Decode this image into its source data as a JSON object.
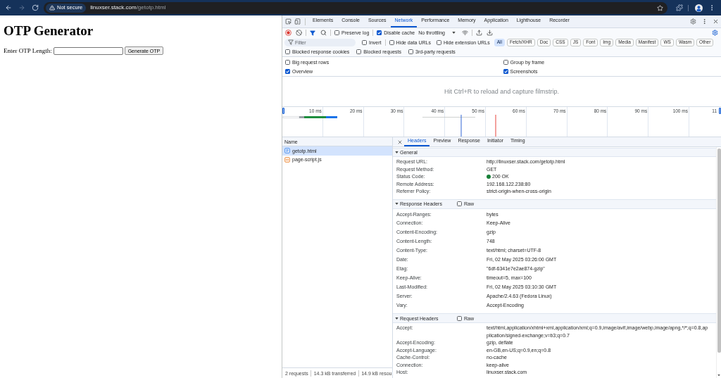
{
  "browser": {
    "security_chip": "Not secure",
    "url_host": "linuxser.stack.com",
    "url_path": "/getotp.html"
  },
  "page": {
    "heading": "OTP Generator",
    "length_label": "Enter OTP Length:",
    "submit_button": "Generate OTP"
  },
  "devtools": {
    "tabs": [
      {
        "label": "Elements",
        "selected": false
      },
      {
        "label": "Console",
        "selected": false
      },
      {
        "label": "Sources",
        "selected": false
      },
      {
        "label": "Network",
        "selected": true
      },
      {
        "label": "Performance",
        "selected": false
      },
      {
        "label": "Memory",
        "selected": false
      },
      {
        "label": "Application",
        "selected": false
      },
      {
        "label": "Lighthouse",
        "selected": false
      },
      {
        "label": "Recorder",
        "selected": false
      }
    ],
    "toolbar": {
      "recording": true,
      "filter_open": true,
      "options": [
        {
          "label": "Preserve log",
          "checked": false
        },
        {
          "label": "Disable cache",
          "checked": true
        }
      ],
      "throttling": "No throttling",
      "settings_open": true
    },
    "filter": {
      "placeholder": "Filter",
      "options": [
        {
          "label": "Invert",
          "checked": false
        },
        {
          "label": "Hide data URLs",
          "checked": false
        },
        {
          "label": "Hide extension URLs",
          "checked": false
        }
      ],
      "types": [
        {
          "label": "All",
          "selected": true
        },
        {
          "label": "Fetch/XHR",
          "selected": false
        },
        {
          "label": "Doc",
          "selected": false
        },
        {
          "label": "CSS",
          "selected": false
        },
        {
          "label": "JS",
          "selected": false
        },
        {
          "label": "Font",
          "selected": false
        },
        {
          "label": "Img",
          "selected": false
        },
        {
          "label": "Media",
          "selected": false
        },
        {
          "label": "Manifest",
          "selected": false
        },
        {
          "label": "WS",
          "selected": false
        },
        {
          "label": "Wasm",
          "selected": false
        },
        {
          "label": "Other",
          "selected": false
        }
      ],
      "more_options": [
        {
          "label": "Blocked response cookies",
          "checked": false
        },
        {
          "label": "Blocked requests",
          "checked": false
        },
        {
          "label": "3rd-party requests",
          "checked": false
        }
      ]
    },
    "settings": [
      {
        "label": "Big request rows",
        "checked": false
      },
      {
        "label": "Group by frame",
        "checked": false
      },
      {
        "label": "Overview",
        "checked": true
      },
      {
        "label": "Screenshots",
        "checked": true
      }
    ],
    "filmstrip_hint": "Hit Ctrl+R to reload and capture filmstrip.",
    "overview_ticks": [
      "10 ms",
      "20 ms",
      "30 ms",
      "40 ms",
      "50 ms",
      "60 ms",
      "70 ms",
      "80 ms",
      "90 ms",
      "100 ms",
      "11"
    ],
    "requests": {
      "column": "Name",
      "rows": [
        {
          "name": "getotp.html",
          "kind": "document",
          "selected": true
        },
        {
          "name": "page-script.js",
          "kind": "script",
          "selected": false
        }
      ]
    },
    "summary": [
      "2 requests",
      "14.3 kB transferred",
      "14.9 kB resou"
    ],
    "detail_tabs": [
      {
        "label": "Headers",
        "selected": true
      },
      {
        "label": "Preview",
        "selected": false
      },
      {
        "label": "Response",
        "selected": false
      },
      {
        "label": "Initiator",
        "selected": false
      },
      {
        "label": "Timing",
        "selected": false
      }
    ],
    "sections": [
      {
        "title": "General",
        "expanded": true,
        "rows": [
          {
            "key": "Request URL:",
            "value": "http://linuxser.stack.com/getotp.html"
          },
          {
            "key": "Request Method:",
            "value": "GET"
          },
          {
            "key": "Status Code:",
            "value": "200 OK",
            "color": "#188038"
          },
          {
            "key": "Remote Address:",
            "value": "192.168.122.238:80"
          },
          {
            "key": "Referrer Policy:",
            "value": "strict-origin-when-cross-origin"
          }
        ]
      },
      {
        "title": "Response Headers",
        "expanded": true,
        "raw": {
          "label": "Raw",
          "checked": false
        },
        "rows": [
          {
            "key": "Accept-Ranges:",
            "value": "bytes"
          },
          {
            "key": "Connection:",
            "value": "Keep-Alive"
          },
          {
            "key": "Content-Encoding:",
            "value": "gzip"
          },
          {
            "key": "Content-Length:",
            "value": "748"
          },
          {
            "key": "Content-Type:",
            "value": "text/html; charset=UTF-8"
          },
          {
            "key": "Date:",
            "value": "Fri, 02 May 2025 03:26:00 GMT"
          },
          {
            "key": "Etag:",
            "value": "\"6df-6341e7e2ae874-gzip\""
          },
          {
            "key": "Keep-Alive:",
            "value": "timeout=5, max=100"
          },
          {
            "key": "Last-Modified:",
            "value": "Fri, 02 May 2025 03:10:30 GMT"
          },
          {
            "key": "Server:",
            "value": "Apache/2.4.63 (Fedora Linux)"
          },
          {
            "key": "Vary:",
            "value": "Accept-Encoding"
          }
        ]
      },
      {
        "title": "Request Headers",
        "expanded": true,
        "raw": {
          "label": "Raw",
          "checked": false
        },
        "rows": [
          {
            "key": "Accept:",
            "value": "text/html,application/xhtml+xml,application/xml;q=0.9,image/avif,image/webp,image/apng,*/*;q=0.8,application/signed-exchange;v=b3;q=0.7"
          },
          {
            "key": "Accept-Encoding:",
            "value": "gzip, deflate"
          },
          {
            "key": "Accept-Language:",
            "value": "en-GB,en-US;q=0.9,en;q=0.8"
          },
          {
            "key": "Cache-Control:",
            "value": "no-cache"
          },
          {
            "key": "Connection:",
            "value": "keep-alive"
          },
          {
            "key": "Host:",
            "value": "linuxser.stack.com"
          }
        ]
      }
    ]
  }
}
